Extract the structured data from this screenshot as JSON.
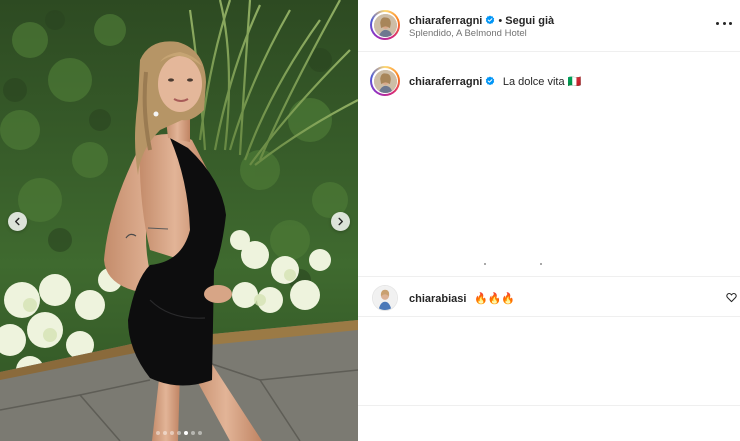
{
  "post": {
    "header": {
      "username": "chiaraferragni",
      "verified": true,
      "separator": "•",
      "follow_label": "Segui già",
      "location": "Splendido, A Belmond Hotel",
      "more_icon": "more-horizontal-icon"
    },
    "caption": {
      "username": "chiaraferragni",
      "verified": true,
      "text": "La dolce vita 🇮🇹"
    },
    "comments": [
      {
        "username": "chiarabiasi",
        "text": "🔥🔥🔥",
        "like_icon": "heart-icon"
      }
    ],
    "carousel": {
      "slide_count": 7,
      "active_index": 4,
      "prev_icon": "chevron-left-icon",
      "next_icon": "chevron-right-icon"
    }
  },
  "colors": {
    "verified_badge": "#0095f6",
    "text_primary": "#262626",
    "text_secondary": "#737373",
    "divider": "#efefef"
  }
}
